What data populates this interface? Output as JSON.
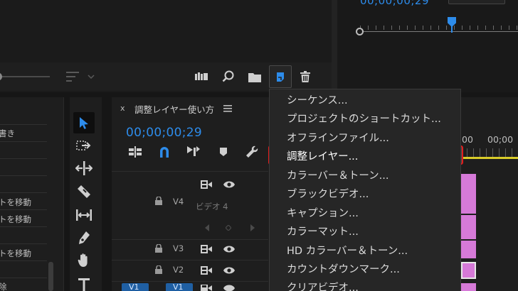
{
  "program_monitor": {
    "timecode": "00;00;00;29"
  },
  "timeline": {
    "sequence_tab": "調整レイヤー使い方",
    "close_x": "x",
    "timecode": "00;00;00;29",
    "ruler_label": "00",
    "ruler_label_2": "00;00",
    "tracks": [
      {
        "name": "V4",
        "caption": "ビデオ 4"
      },
      {
        "name": "V3"
      },
      {
        "name": "V2"
      },
      {
        "name": "V1",
        "source": "V1"
      }
    ]
  },
  "history": {
    "items": [
      "書き",
      "トを移動",
      "トを移動",
      "トを移動",
      "除"
    ]
  },
  "new_item_menu": {
    "items": [
      "シーケンス...",
      "プロジェクトのショートカット...",
      "オフラインファイル...",
      "調整レイヤー...",
      "カラーバー＆トーン...",
      "ブラックビデオ...",
      "キャプション...",
      "カラーマット...",
      "HD カラーバー＆トーン...",
      "カウントダウンマーク...",
      "クリアビデオ..."
    ],
    "highlighted_index": 3
  },
  "colors": {
    "accent": "#2d8ceb",
    "highlight_border": "#e11c1c",
    "clip": "#d67ad8",
    "playhead_yellow": "#d9cc2a"
  }
}
